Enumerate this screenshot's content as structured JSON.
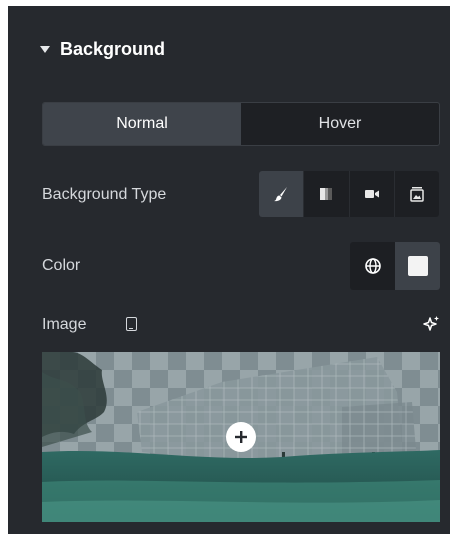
{
  "section": {
    "title": "Background",
    "expand_icon": "caret-down-icon"
  },
  "state_tabs": [
    {
      "label": "Normal",
      "active": true
    },
    {
      "label": "Hover",
      "active": false
    }
  ],
  "background_type": {
    "label": "Background Type",
    "options": [
      {
        "icon": "brush-icon",
        "active": true
      },
      {
        "icon": "gradient-icon",
        "active": false
      },
      {
        "icon": "video-icon",
        "active": false
      },
      {
        "icon": "slideshow-icon",
        "active": false
      }
    ]
  },
  "color": {
    "label": "Color",
    "global_icon": "globe-icon",
    "value": "#f3f3f3"
  },
  "image": {
    "label": "Image",
    "responsive_icon": "tablet-icon",
    "ai_icon": "sparkle-icon",
    "add_icon": "plus-icon"
  },
  "colors": {
    "panel": "#26292e",
    "active_tab": "#3f444b",
    "text": "#d5d8dc"
  }
}
